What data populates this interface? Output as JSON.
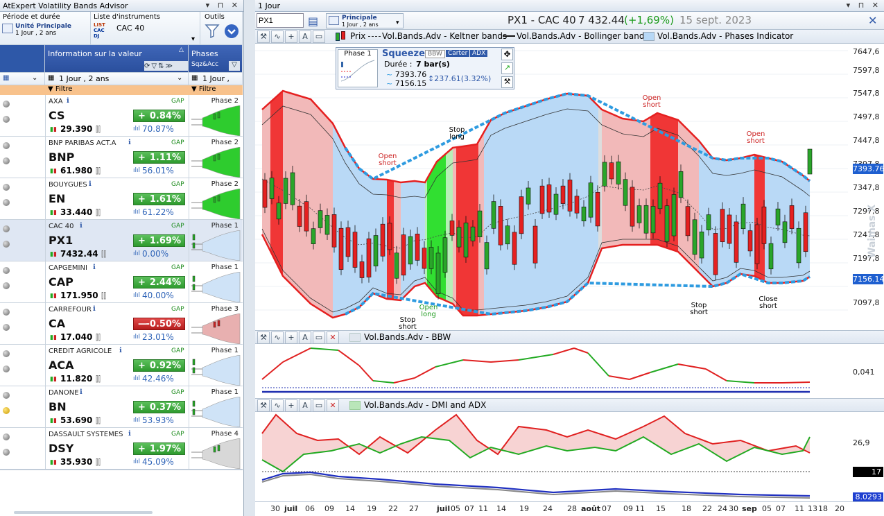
{
  "left": {
    "window_title": "AtExpert Volatility Bands Advisor",
    "window_controls": "▾ ⊓ ✕",
    "period_label": "Période et durée",
    "period_main": "Unité Principale",
    "period_sub": "1 Jour , 2 ans",
    "instruments_label": "Liste d'instruments",
    "instruments_value": "CAC 40",
    "instr_tags": [
      "LIST",
      "CAC",
      "DJ"
    ],
    "tools_label": "Outils",
    "col_info": "Information sur la valeur",
    "col_phases": "Phases",
    "col_phases_sub": "Sqz&Acc",
    "filter_period": "1 Jour , 2 ans",
    "filter_period_short": "1 Jour ,",
    "filter_label": "Filtre",
    "gap_label": "GAP",
    "rows": [
      {
        "name": "AXA",
        "ticker": "CS",
        "price": "29.390",
        "change": "0.84%",
        "sign": "+",
        "pct": "70.87%",
        "phase": "Phase 2",
        "dir": "up"
      },
      {
        "name": "BNP PARIBAS ACT.A",
        "ticker": "BNP",
        "price": "61.980",
        "change": "1.11%",
        "sign": "+",
        "pct": "56.01%",
        "phase": "Phase 2",
        "dir": "up"
      },
      {
        "name": "BOUYGUES",
        "ticker": "EN",
        "price": "33.440",
        "change": "1.61%",
        "sign": "+",
        "pct": "61.22%",
        "phase": "Phase 2",
        "dir": "up"
      },
      {
        "name": "CAC 40",
        "ticker": "PX1",
        "price": "7432.44",
        "change": "1.69%",
        "sign": "+",
        "pct": "0.00%",
        "phase": "Phase 1",
        "dir": "up"
      },
      {
        "name": "CAPGEMINI",
        "ticker": "CAP",
        "price": "171.950",
        "change": "2.44%",
        "sign": "+",
        "pct": "40.00%",
        "phase": "Phase 1",
        "dir": "up"
      },
      {
        "name": "CARREFOUR",
        "ticker": "CA",
        "price": "17.040",
        "change": "-0.50%",
        "sign": "—",
        "pct": "23.01%",
        "phase": "Phase 3",
        "dir": "dn"
      },
      {
        "name": "CREDIT AGRICOLE",
        "ticker": "ACA",
        "price": "11.820",
        "change": "0.92%",
        "sign": "+",
        "pct": "42.46%",
        "phase": "Phase 1",
        "dir": "up"
      },
      {
        "name": "DANONE",
        "ticker": "BN",
        "price": "53.690",
        "change": "0.37%",
        "sign": "+",
        "pct": "53.93%",
        "phase": "Phase 1",
        "dir": "up"
      },
      {
        "name": "DASSAULT SYSTEMES",
        "ticker": "DSY",
        "price": "35.930",
        "change": "1.97%",
        "sign": "+",
        "pct": "45.09%",
        "phase": "Phase 4",
        "dir": "up"
      }
    ]
  },
  "right": {
    "window_title": "1 Jour",
    "symbol_input": "PX1",
    "chart_mode": "Principale",
    "chart_mode_sub": "1 Jour , 2 ans",
    "instrument_title": "PX1 - CAC 40",
    "last_price": "7 432.44",
    "change": "(+1,69%)",
    "date": "15 sept. 2023",
    "legend": {
      "prix": "Prix",
      "keltner": "Vol.Bands.Adv - Keltner bands",
      "bollinger": "Vol.Bands.Adv - Bollinger bands",
      "phases": "Vol.Bands.Adv - Phases Indicator"
    },
    "infobox": {
      "phase": "Phase 1",
      "state": "Squeeze",
      "b1": "BBW",
      "b2": "Carter",
      "b3": "ADX",
      "duree_label": "Durée :",
      "duree_value": "7 bar(s)",
      "upper": "7393.76",
      "lower": "7156.15",
      "delta": "237.61(3.32%)"
    },
    "panel2_title": "Vol.Bands.Adv - BBW",
    "panel3_title": "Vol.Bands.Adv - DMI and ADX",
    "y_ticks": [
      "7647,6",
      "7597,8",
      "7547,8",
      "7497,8",
      "7447,8",
      "7397,8",
      "7347,8",
      "7297,8",
      "7247,8",
      "7197,8",
      "7097,8"
    ],
    "tag_upper": "7393.76",
    "tag_lower": "7156.14",
    "bbw_tick": "0,041",
    "dmi_tick": "26,9",
    "tag_adx1": "17",
    "tag_adx2": "8.0293",
    "watermark": "Waimas X",
    "x_ticks": [
      "30",
      "juil",
      "06",
      "09",
      "14",
      "19",
      "22",
      "27",
      "juil",
      "05",
      "07",
      "11",
      "14",
      "19",
      "24",
      "28",
      "août",
      "07",
      "09",
      "11",
      "15",
      "18",
      "22",
      "24",
      "30",
      "sep",
      "05",
      "07",
      "11",
      "13",
      "18",
      "20"
    ],
    "annotations": {
      "open_short": "Open short",
      "stop_long": "Stop long",
      "stop_short": "Stop short",
      "open_long": "Open long",
      "close_short": "Close short"
    },
    "colors": {
      "up": "#2aa52a",
      "down": "#e52020",
      "band_blue": "#2e9be0",
      "fill_blue": "#b7d8f6",
      "fill_red": "#f2b9b9"
    }
  }
}
